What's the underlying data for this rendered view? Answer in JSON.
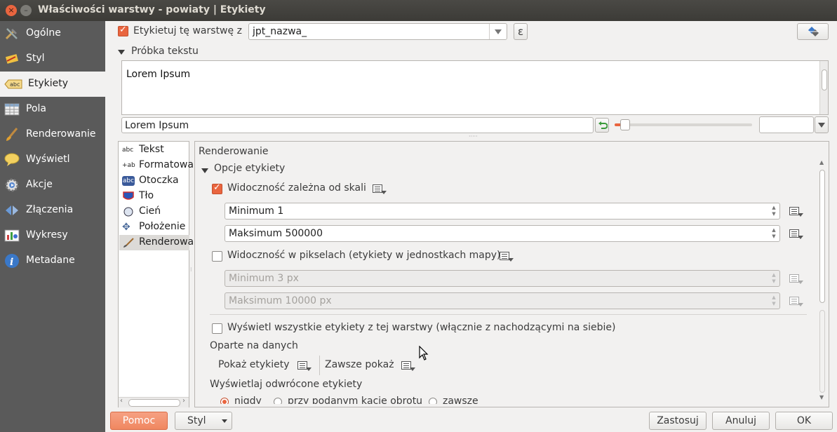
{
  "window": {
    "title": "Właściwości warstwy - powiaty | Etykiety",
    "close_glyph": "×",
    "minimize_glyph": "–"
  },
  "sidebar": {
    "items": [
      {
        "label": "Ogólne",
        "icon": "tools-icon"
      },
      {
        "label": "Styl",
        "icon": "brush-icon"
      },
      {
        "label": "Etykiety",
        "icon": "labels-icon",
        "active": true
      },
      {
        "label": "Pola",
        "icon": "table-icon"
      },
      {
        "label": "Renderowanie",
        "icon": "paintbrush-icon"
      },
      {
        "label": "Wyświetl",
        "icon": "speech-bubble-icon"
      },
      {
        "label": "Akcje",
        "icon": "gear-run-icon"
      },
      {
        "label": "Złączenia",
        "icon": "join-icon"
      },
      {
        "label": "Wykresy",
        "icon": "chart-icon"
      },
      {
        "label": "Metadane",
        "icon": "info-icon"
      }
    ]
  },
  "top": {
    "label_layer_checkbox_label": "Etykietuj tę warstwę z",
    "label_field_value": "jpt_nazwa_",
    "expression_button": "ε",
    "sample_section_title": "Próbka tekstu",
    "sample_preview_text": "Lorem Ipsum",
    "sample_input_value": "Lorem Ipsum",
    "sample_color_value": ""
  },
  "subtabs": [
    {
      "label": "Tekst",
      "icon_glyph": "abc"
    },
    {
      "label": "Formatowanie",
      "icon_glyph": "+ab"
    },
    {
      "label": "Otoczka",
      "icon_glyph": "abc"
    },
    {
      "label": "Tło",
      "icon_glyph": ""
    },
    {
      "label": "Cień",
      "icon_glyph": ""
    },
    {
      "label": "Położenie",
      "icon_glyph": "✥"
    },
    {
      "label": "Renderowanie",
      "icon_glyph": ""
    }
  ],
  "panel": {
    "title": "Renderowanie",
    "group_title": "Opcje etykiety",
    "scale_visibility_label": "Widoczność zależna od skali",
    "scale_min_value": "Minimum 1",
    "scale_max_value": "Maksimum 500000",
    "pixel_visibility_label": "Widoczność w pikselach (etykiety w jednostkach mapy)",
    "pixel_min_value": "Minimum 3 px",
    "pixel_max_value": "Maksimum 10000 px",
    "show_all_label": "Wyświetl wszystkie etykiety z tej warstwy (włącznie z nachodzącymi na siebie)",
    "data_defined_title": "Oparte na danych",
    "show_label_text": "Pokaż etykiety",
    "always_show_text": "Zawsze pokaż",
    "upside_down_title": "Wyświetlaj odwrócone etykiety",
    "upside_options": [
      "nigdy",
      "przy podanym kącie obrotu",
      "zawsze"
    ]
  },
  "footer": {
    "help": "Pomoc",
    "style": "Styl",
    "apply": "Zastosuj",
    "cancel": "Anuluj",
    "ok": "OK"
  },
  "colors": {
    "accent": "#e9653f",
    "sidebar_bg": "#5a5a5a",
    "titlebar_bg": "#3c3b37"
  }
}
